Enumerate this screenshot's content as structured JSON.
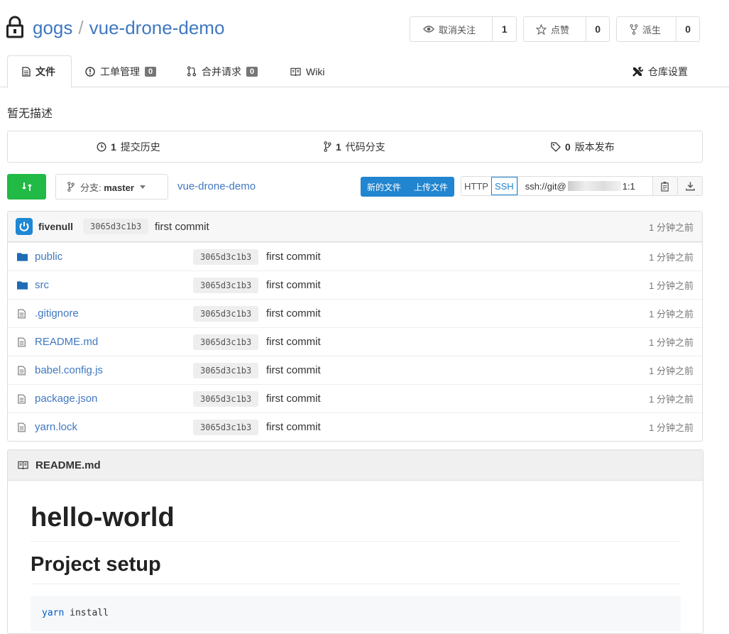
{
  "repo": {
    "owner": "gogs",
    "name": "vue-drone-demo",
    "separator": "/"
  },
  "header_buttons": {
    "watch": {
      "label": "取消关注",
      "count": "1"
    },
    "star": {
      "label": "点赞",
      "count": "0"
    },
    "fork": {
      "label": "派生",
      "count": "0"
    }
  },
  "tabs": [
    {
      "label": "文件"
    },
    {
      "label": "工单管理",
      "badge": "0"
    },
    {
      "label": "合并请求",
      "badge": "0"
    },
    {
      "label": "Wiki"
    },
    {
      "label": "仓库设置"
    }
  ],
  "description": "暂无描述",
  "stats": {
    "commits": {
      "count": "1",
      "label": "提交历史"
    },
    "branches": {
      "count": "1",
      "label": "代码分支"
    },
    "releases": {
      "count": "0",
      "label": "版本发布"
    }
  },
  "toolbar": {
    "branch_prefix": "分支:",
    "branch_name": "master",
    "breadcrumb": "vue-drone-demo",
    "new_file": "新的文件",
    "upload_file": "上传文件",
    "http": "HTTP",
    "ssh": "SSH",
    "clone_url_start": "ssh://git@",
    "clone_url_end": "1:1"
  },
  "latest_commit": {
    "author": "fivenull",
    "sha": "3065d3c1b3",
    "message": "first commit",
    "age": "1 分钟之前"
  },
  "files": [
    {
      "name": "public",
      "type": "folder",
      "sha": "3065d3c1b3",
      "message": "first commit",
      "age": "1 分钟之前"
    },
    {
      "name": "src",
      "type": "folder",
      "sha": "3065d3c1b3",
      "message": "first commit",
      "age": "1 分钟之前"
    },
    {
      "name": ".gitignore",
      "type": "file",
      "sha": "3065d3c1b3",
      "message": "first commit",
      "age": "1 分钟之前"
    },
    {
      "name": "README.md",
      "type": "file",
      "sha": "3065d3c1b3",
      "message": "first commit",
      "age": "1 分钟之前"
    },
    {
      "name": "babel.config.js",
      "type": "file",
      "sha": "3065d3c1b3",
      "message": "first commit",
      "age": "1 分钟之前"
    },
    {
      "name": "package.json",
      "type": "file",
      "sha": "3065d3c1b3",
      "message": "first commit",
      "age": "1 分钟之前"
    },
    {
      "name": "yarn.lock",
      "type": "file",
      "sha": "3065d3c1b3",
      "message": "first commit",
      "age": "1 分钟之前"
    }
  ],
  "readme": {
    "filename": "README.md",
    "h1": "hello-world",
    "h2": "Project setup",
    "code_cmd": "yarn",
    "code_arg": "install"
  },
  "colors": {
    "link": "#4078c0",
    "green": "#21ba45",
    "blue": "#2185d0"
  }
}
